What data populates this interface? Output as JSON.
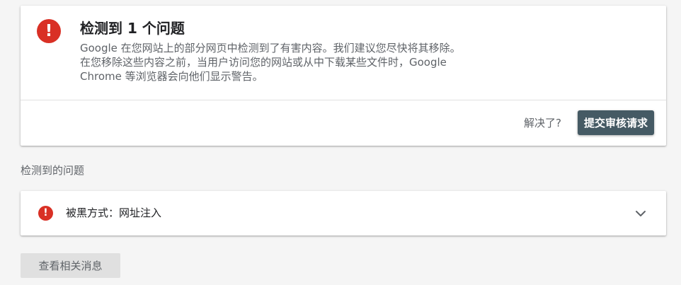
{
  "issue_card": {
    "title": "检测到 1 个问题",
    "description_lines": [
      "Google 在您网站上的部分网页中检测到了有害内容。我们建议您尽快将其移除。",
      "在您移除这些内容之前，当用户访问您的网站或从中下载某些文件时，Google",
      "Chrome 等浏览器会向他们显示警告。"
    ],
    "resolved_prompt": "解决了?",
    "submit_button_label": "提交审核请求",
    "alert_icon_glyph": "!",
    "alert_color": "#d93025",
    "button_color": "#455a64"
  },
  "detected_section": {
    "heading": "检测到的问题",
    "items": [
      {
        "label": "被黑方式：网址注入",
        "icon": "alert-icon",
        "icon_glyph": "!"
      }
    ]
  },
  "footer": {
    "related_news_button_label": "查看相关消息"
  }
}
